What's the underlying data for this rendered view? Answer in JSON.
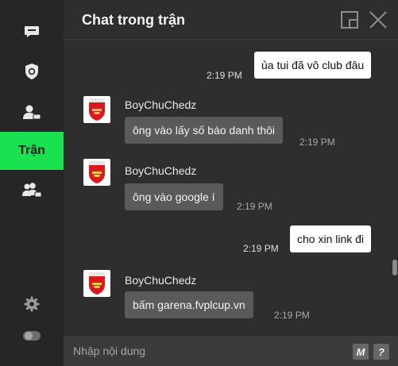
{
  "sidebar": {
    "items": [
      {
        "icon": "chat-bubble-icon"
      },
      {
        "icon": "club-shield-icon"
      },
      {
        "icon": "user-chat-icon"
      },
      {
        "label": "Trận",
        "active": true
      },
      {
        "icon": "group-chat-icon"
      }
    ],
    "settings_icon": "gear-icon",
    "toggle_icon": "toggle-icon"
  },
  "header": {
    "title": "Chat trong trận",
    "popout_icon": "popout-icon",
    "close_icon": "close-icon"
  },
  "messages": [
    {
      "own": true,
      "text": "ủa tui đã vô club đâu",
      "time": "2:19 PM"
    },
    {
      "own": false,
      "user": "BoyChuChedz",
      "text": "ông vào lấy số báo danh thôi",
      "time": "2:19 PM"
    },
    {
      "own": false,
      "user": "BoyChuChedz",
      "text": "ông vào google í",
      "time": "2:19 PM"
    },
    {
      "own": true,
      "text": "cho xin link đi",
      "time": "2:19 PM"
    },
    {
      "own": false,
      "user": "BoyChuChedz",
      "text": "bấm garena.fvplcup.vn",
      "time": "2:19 PM"
    }
  ],
  "input": {
    "placeholder": "Nhập nội dung",
    "macro_label": "M",
    "help_label": "?"
  },
  "colors": {
    "accent": "#19e14f",
    "own_bubble": "#ffffff",
    "other_bubble": "#5a5a5a"
  }
}
